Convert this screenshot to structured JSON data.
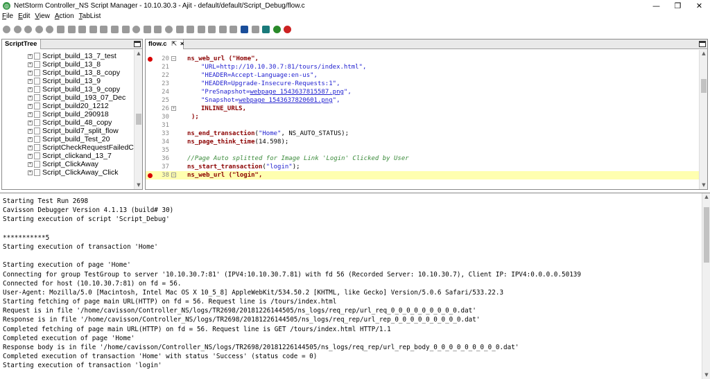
{
  "window": {
    "title": "NetStorm Controller_NS Script Manager - 10.10.30.3 - Ajit - default/default/Script_Debug/flow.c",
    "controls": [
      "—",
      "❐",
      "✕"
    ]
  },
  "menu": [
    {
      "mnemonic": "F",
      "rest": "ile"
    },
    {
      "mnemonic": "E",
      "rest": "dit"
    },
    {
      "mnemonic": "V",
      "rest": "iew"
    },
    {
      "mnemonic": "A",
      "rest": "ction"
    },
    {
      "mnemonic": "T",
      "rest": "abList"
    }
  ],
  "toolbar": {
    "icon_count": 27,
    "accent_colors": {
      "save": "#1a4e9a",
      "play": "#2a8a2a",
      "stop": "#cc2222",
      "pause": "#1a7a7a"
    }
  },
  "script_tree": {
    "tab_label": "ScriptTree",
    "items": [
      "Script_build_13_7_test",
      "Script_build_13_8",
      "Script_build_13_8_copy",
      "Script_build_13_9",
      "Script_build_13_9_copy",
      "Script_build_193_07_Dec",
      "Script_build20_1212",
      "Script_build_290918",
      "Script_build_48_copy",
      "Script_build7_split_flow",
      "Script_build_Test_20",
      "ScriptCheckRequestFailedC",
      "Script_clickand_13_7",
      "Script_ClickAway",
      "Script_ClickAway_Click"
    ]
  },
  "editor": {
    "tab_label": "flow.c",
    "tab_pin": "⇱",
    "tab_close": "×",
    "lines": [
      {
        "num": "20",
        "bp": true,
        "fold": "⊟",
        "hl": false
      },
      {
        "num": "21",
        "bp": false,
        "fold": "",
        "hl": false
      },
      {
        "num": "22",
        "bp": false,
        "fold": "",
        "hl": false
      },
      {
        "num": "23",
        "bp": false,
        "fold": "",
        "hl": false
      },
      {
        "num": "24",
        "bp": false,
        "fold": "",
        "hl": false
      },
      {
        "num": "25",
        "bp": false,
        "fold": "",
        "hl": false
      },
      {
        "num": "26",
        "bp": false,
        "fold": "⊞",
        "hl": false
      },
      {
        "num": "30",
        "bp": false,
        "fold": "",
        "hl": false
      },
      {
        "num": "31",
        "bp": false,
        "fold": "",
        "hl": false
      },
      {
        "num": "33",
        "bp": false,
        "fold": "",
        "hl": false
      },
      {
        "num": "34",
        "bp": false,
        "fold": "",
        "hl": false
      },
      {
        "num": "35",
        "bp": false,
        "fold": "",
        "hl": false
      },
      {
        "num": "36",
        "bp": false,
        "fold": "",
        "hl": false
      },
      {
        "num": "37",
        "bp": false,
        "fold": "",
        "hl": false
      },
      {
        "num": "38",
        "bp": true,
        "fold": "⊟",
        "hl": true
      }
    ],
    "code": {
      "l20_fn": "ns_web_url",
      "l20_arg": " (\"Home\",",
      "l21": "\"URL=http://10.10.30.7:81/tours/index.html\",",
      "l22": "\"HEADER=Accept-Language:en-us\",",
      "l23": "\"HEADER=Upgrade-Insecure-Requests:1\",",
      "l24_pre": "\"PreSnapshot=",
      "l24_link": "webpage_1543637815587.png",
      "l24_post": "\",",
      "l25_pre": "\"Snapshot=",
      "l25_link": "webpage_1543637820601.png",
      "l25_post": "\",",
      "l26": "INLINE_URLS,",
      "l30": ");",
      "l33_fn": "ns_end_transaction",
      "l33_open": "(",
      "l33_str": "\"Home\"",
      "l33_rest": ", NS_AUTO_STATUS);",
      "l34_fn": "ns_page_think_time",
      "l34_rest": "(14.598);",
      "l36": "//Page Auto splitted for Image Link 'Login' Clicked by User",
      "l37_fn": "ns_start_transaction",
      "l37_open": "(",
      "l37_str": "\"login\"",
      "l37_rest": ");",
      "l38_fn": "ns_web_url",
      "l38_arg": " (\"login\","
    }
  },
  "console": {
    "lines": [
      "Starting Test Run 2698",
      "Cavisson Debugger Version 4.1.13 (build# 30)",
      "Starting execution of script 'Script_Debug'",
      "",
      "***********5",
      "Starting execution of transaction 'Home'",
      "",
      "Starting execution of page 'Home'",
      "Connecting for group TestGroup to server '10.10.30.7:81' (IPV4:10.10.30.7.81) with fd 56 (Recorded Server: 10.10.30.7), Client IP: IPV4:0.0.0.0.50139",
      "Connected for host (10.10.30.7:81) on fd = 56.",
      "User-Agent: Mozilla/5.0 [Macintosh, Intel Mac OS X 10_5_8] AppleWebKit/534.50.2 [KHTML, like Gecko] Version/5.0.6 Safari/533.22.3",
      "Starting fetching of page main URL(HTTP) on fd = 56. Request line is /tours/index.html",
      "Request is in file '/home/cavisson/Controller_NS/logs/TR2698/20181226144505/ns_logs/req_rep/url_req_0_0_0_0_0_0_0_0_0.dat'",
      "Response is in file '/home/cavisson/Controller_NS/logs/TR2698/20181226144505/ns_logs/req_rep/url_rep_0_0_0_0_0_0_0_0_0.dat'",
      "Completed fetching of page main URL(HTTP) on fd = 56. Request line is GET /tours/index.html HTTP/1.1",
      "Completed execution of page 'Home'",
      "Response body is in file '/home/cavisson/Controller_NS/logs/TR2698/20181226144505/ns_logs/req_rep/url_rep_body_0_0_0_0_0_0_0_0_0.dat'",
      "Completed execution of transaction 'Home' with status 'Success' (status code = 0)",
      "Starting execution of transaction 'login'"
    ]
  }
}
